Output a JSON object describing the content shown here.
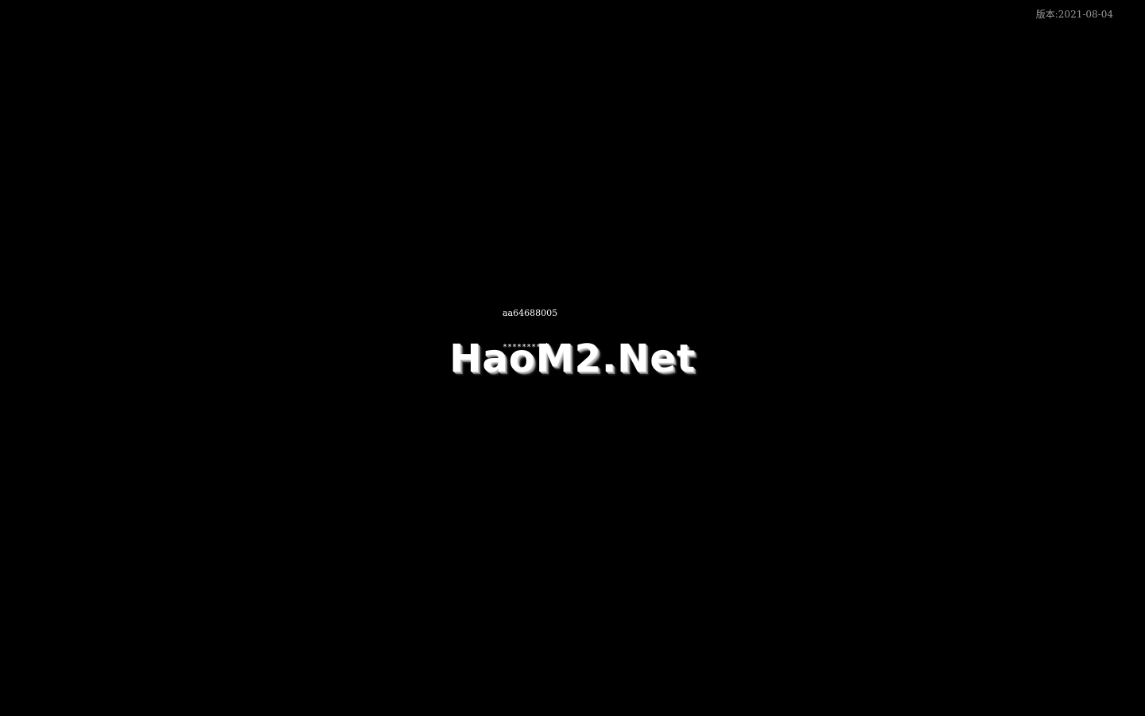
{
  "version": {
    "label": "版本:2021-08-04"
  },
  "login": {
    "account_value": "aa64688005",
    "password_masked": "*********"
  },
  "logo": {
    "text": "HaoM2.Net"
  },
  "colors": {
    "background": "#000000",
    "version_text": "#9a9a9a",
    "field_text": "#ffffff"
  }
}
